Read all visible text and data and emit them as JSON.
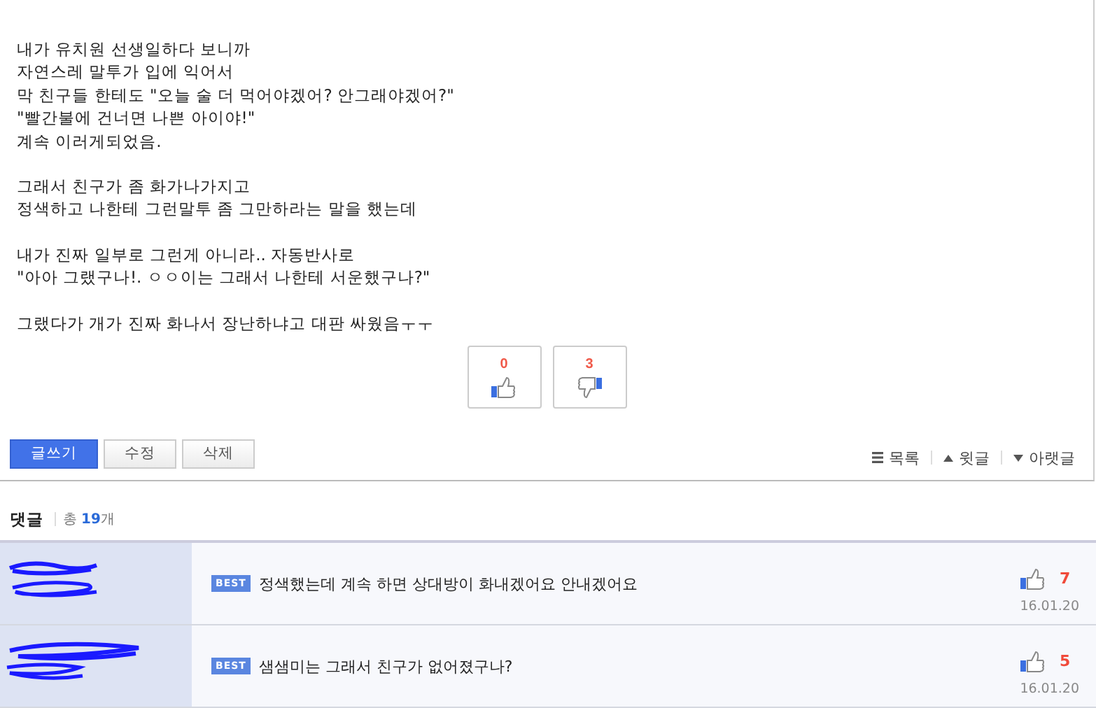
{
  "post": {
    "paragraphs": [
      [
        "내가 유치원 선생일하다 보니까",
        "자연스레 말투가 입에 익어서",
        "막 친구들 한테도 \"오늘 술 더 먹어야겠어? 안그래야겠어?\"",
        "\"빨간불에 건너면 나쁜 아이야!\"",
        "계속 이러게되었음."
      ],
      [
        "그래서 친구가 좀 화가나가지고",
        "정색하고 나한테 그런말투 좀 그만하라는 말을 했는데"
      ],
      [
        "내가 진짜 일부로 그런게 아니라.. 자동반사로",
        "\"아아 그랬구나!. ㅇㅇ이는 그래서 나한테 서운했구나?\""
      ],
      [
        "그랬다가 개가 진짜 화나서 장난하냐고 대판 싸웠음ㅜㅜ"
      ]
    ]
  },
  "votes": [
    {
      "kind": "up",
      "count": "0"
    },
    {
      "kind": "down",
      "count": "3"
    }
  ],
  "toolbar": {
    "buttons": [
      {
        "label": "글쓰기",
        "primary": true
      },
      {
        "label": "수정",
        "primary": false
      },
      {
        "label": "삭제",
        "primary": false
      }
    ],
    "nav": [
      {
        "kind": "list",
        "label": "목록"
      },
      {
        "kind": "up",
        "label": "윗글"
      },
      {
        "kind": "down",
        "label": "아랫글"
      }
    ]
  },
  "comments_header": {
    "title": "댓글",
    "total_label": "총",
    "count": "19",
    "unit": "개"
  },
  "comments": [
    {
      "badge": "BEST",
      "text": "정색했는데 계속 하면 상대방이 화내겠어요 안내겠어요",
      "likes": "7",
      "date": "16.01.20"
    },
    {
      "badge": "BEST",
      "text": "샘샘미는 그래서 친구가 없어졌구나?",
      "likes": "5",
      "date": "16.01.20"
    }
  ]
}
